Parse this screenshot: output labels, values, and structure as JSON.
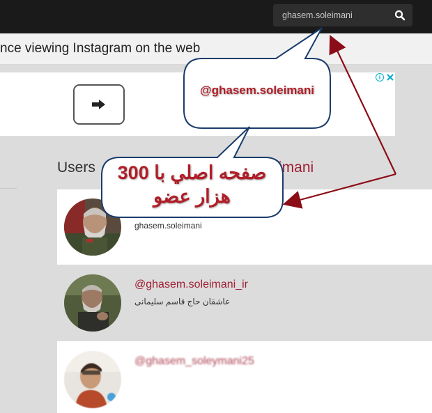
{
  "topbar": {
    "search": {
      "value": "ghasem.soleimani",
      "icon": "search-icon"
    }
  },
  "notice": {
    "text": "nce viewing Instagram on the web"
  },
  "ad": {
    "arrow_icon": "arrow-right-icon",
    "info_icon": "info-icon",
    "close_icon": "close-icon",
    "accent": "#00aecd"
  },
  "results": {
    "heading": "Users",
    "heading_handle": "imani",
    "users": [
      {
        "handle": "",
        "username": "ghasem.soleimani",
        "subtitle": "ghasem.soleimani"
      },
      {
        "handle": "@ghasem.soleimani_ir",
        "subtitle": "عاشقان حاج قاسم سلیمانی"
      },
      {
        "handle": "@ghasem_soleymani25",
        "subtitle": ""
      }
    ]
  },
  "annotations": {
    "callout_1": "@ghasem.soleimani",
    "callout_2_line1": "صفحه اصلي با 300",
    "callout_2_line2": "هزار عضو",
    "text_color": "#b01e28",
    "arrow_color": "#8b0d17"
  },
  "colors": {
    "topbar": "#1a1a1a",
    "link": "#9e1f32"
  }
}
